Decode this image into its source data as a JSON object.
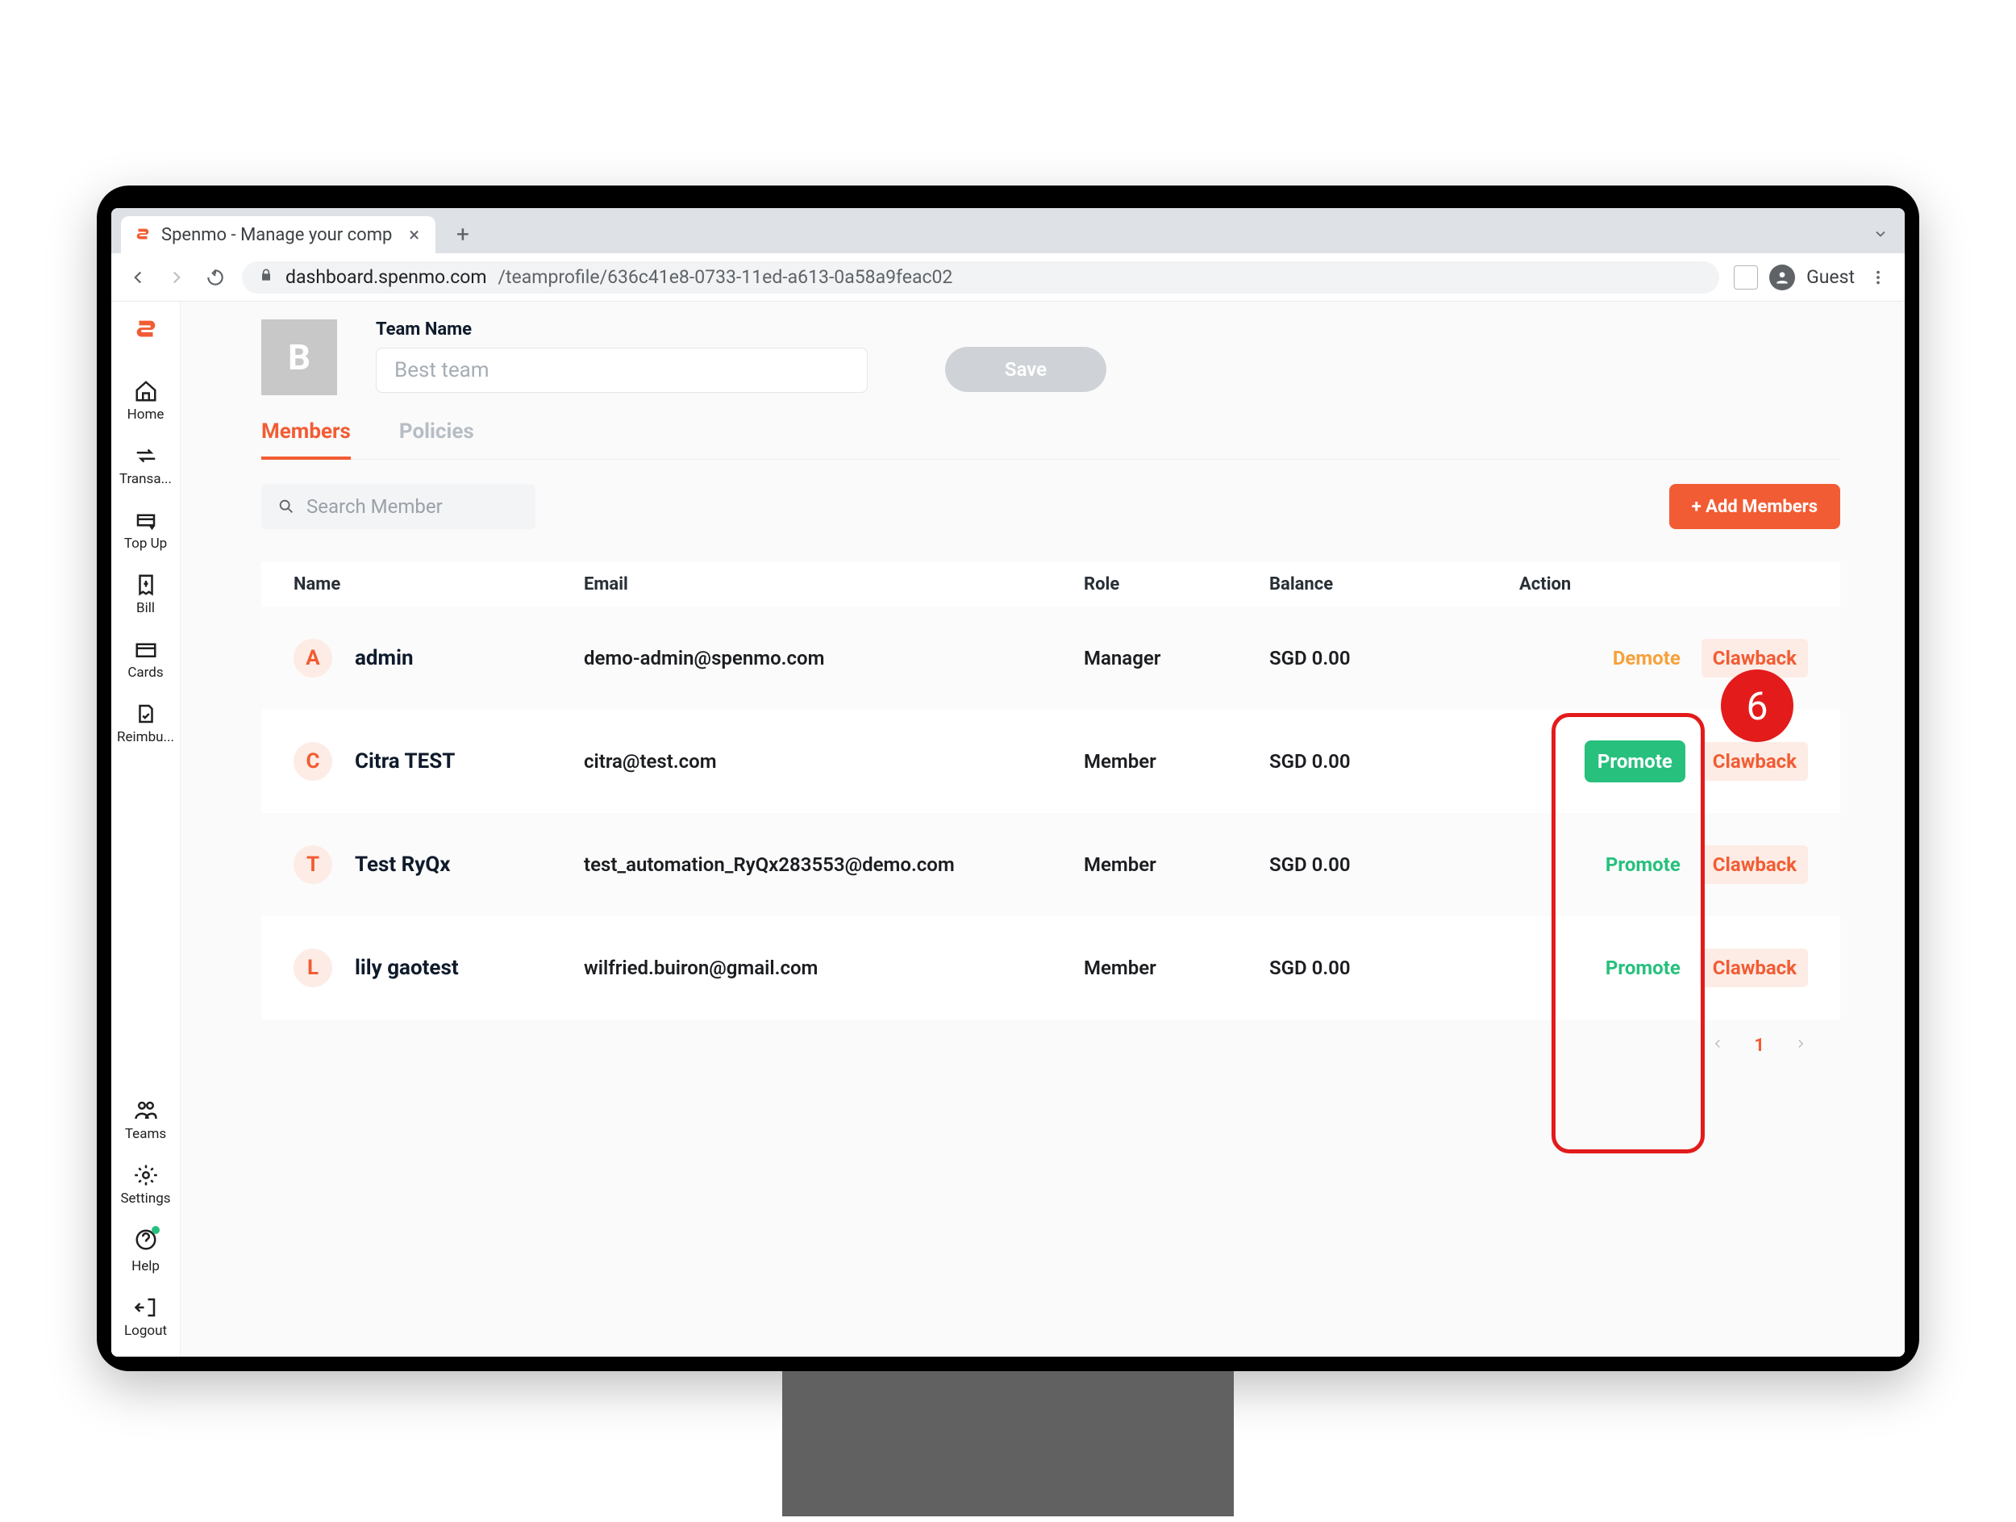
{
  "browser": {
    "tab_title": "Spenmo - Manage your compa",
    "url_host": "dashboard.spenmo.com",
    "url_path": "/teamprofile/636c41e8-0733-11ed-a613-0a58a9feac02",
    "guest_label": "Guest"
  },
  "sidebar": {
    "top": [
      {
        "label": "Home"
      },
      {
        "label": "Transa..."
      },
      {
        "label": "Top Up"
      },
      {
        "label": "Bill"
      },
      {
        "label": "Cards"
      },
      {
        "label": "Reimbu..."
      }
    ],
    "bottom": [
      {
        "label": "Teams"
      },
      {
        "label": "Settings"
      },
      {
        "label": "Help"
      },
      {
        "label": "Logout"
      }
    ]
  },
  "team": {
    "thumb_letter": "B",
    "name_label": "Team Name",
    "name_value": "Best team",
    "save_label": "Save"
  },
  "tabs": {
    "members": "Members",
    "policies": "Policies"
  },
  "search": {
    "placeholder": "Search Member",
    "add_label": "+ Add Members"
  },
  "columns": {
    "name": "Name",
    "email": "Email",
    "role": "Role",
    "balance": "Balance",
    "action": "Action"
  },
  "rows": [
    {
      "letter": "A",
      "name": "admin",
      "email": "demo-admin@spenmo.com",
      "role": "Manager",
      "balance": "SGD 0.00",
      "primary": "Demote",
      "primary_kind": "demote",
      "secondary": "Clawback"
    },
    {
      "letter": "C",
      "name": "Citra TEST",
      "email": "citra@test.com",
      "role": "Member",
      "balance": "SGD 0.00",
      "primary": "Promote",
      "primary_kind": "promote-solid",
      "secondary": "Clawback"
    },
    {
      "letter": "T",
      "name": "Test RyQx",
      "email": "test_automation_RyQx283553@demo.com",
      "role": "Member",
      "balance": "SGD 0.00",
      "primary": "Promote",
      "primary_kind": "promote",
      "secondary": "Clawback"
    },
    {
      "letter": "L",
      "name": "lily gaotest",
      "email": "wilfried.buiron@gmail.com",
      "role": "Member",
      "balance": "SGD 0.00",
      "primary": "Promote",
      "primary_kind": "promote",
      "secondary": "Clawback"
    }
  ],
  "pager": {
    "current": "1"
  },
  "callout": {
    "num": "6"
  }
}
